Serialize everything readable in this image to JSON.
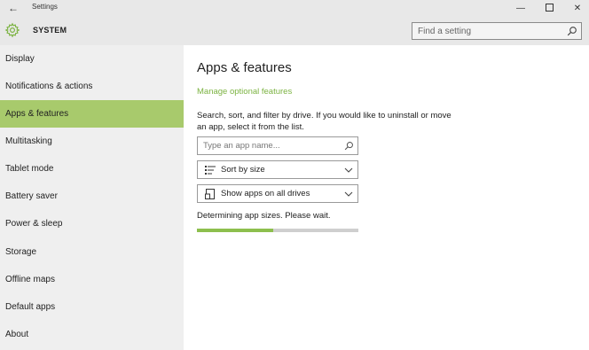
{
  "window": {
    "title": "Settings",
    "back_glyph": "←",
    "minimize_glyph": "—",
    "close_glyph": "✕"
  },
  "header": {
    "section": "SYSTEM",
    "icon": "gear-icon",
    "search_placeholder": "Find a setting"
  },
  "sidebar": {
    "items": [
      {
        "label": "Display",
        "active": false
      },
      {
        "label": "Notifications & actions",
        "active": false
      },
      {
        "label": "Apps & features",
        "active": true
      },
      {
        "label": "Multitasking",
        "active": false
      },
      {
        "label": "Tablet mode",
        "active": false
      },
      {
        "label": "Battery saver",
        "active": false
      },
      {
        "label": "Power & sleep",
        "active": false
      },
      {
        "label": "Storage",
        "active": false
      },
      {
        "label": "Offline maps",
        "active": false
      },
      {
        "label": "Default apps",
        "active": false
      },
      {
        "label": "About",
        "active": false
      }
    ]
  },
  "main": {
    "title": "Apps & features",
    "manage_link": "Manage optional features",
    "instructions": "Search, sort, and filter by drive. If you would like to uninstall or move an app, select it from the list.",
    "app_search_placeholder": "Type an app name...",
    "sort_label": "Sort by size",
    "drive_filter_label": "Show apps on all drives",
    "status": "Determining app sizes. Please wait.",
    "progress_fraction": 0.47
  },
  "colors": {
    "accent": "#7cb342",
    "active_nav": "#a8ca6c",
    "progress_fill": "#8dbf4e",
    "chrome": "#e8e8e8",
    "sidebar": "#efefef"
  }
}
